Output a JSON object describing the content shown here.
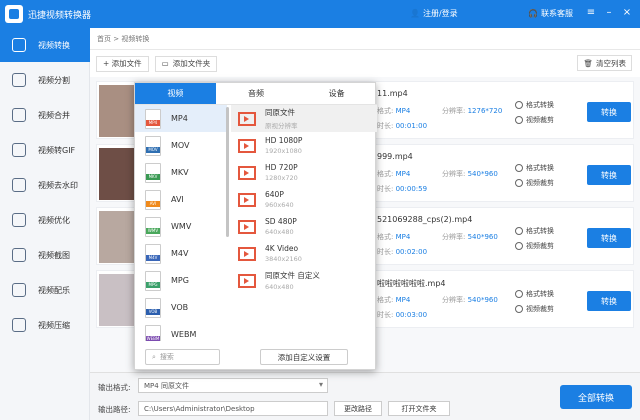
{
  "app": {
    "title": "迅捷视频转换器",
    "login": "注册/登录",
    "support": "联系客服"
  },
  "sidebar": {
    "items": [
      {
        "label": "视频转换"
      },
      {
        "label": "视频分割"
      },
      {
        "label": "视频合并"
      },
      {
        "label": "视频转GIF"
      },
      {
        "label": "视频去水印"
      },
      {
        "label": "视频优化"
      },
      {
        "label": "视频截图"
      },
      {
        "label": "视频配乐"
      },
      {
        "label": "视频压缩"
      }
    ]
  },
  "breadcrumb": "首页 > 视频转换",
  "toolbar": {
    "add_file": "+ 添加文件",
    "add_folder": "添加文件夹",
    "clear": "清空列表"
  },
  "files": [
    {
      "name": "11.mp4",
      "format_label": "格式:",
      "format": "MP4",
      "res_label": "分辨率:",
      "res": "1276*720",
      "dur_label": "时长:",
      "dur": "00:01:00"
    },
    {
      "name": "999.mp4",
      "format_label": "格式:",
      "format": "MP4",
      "res_label": "分辨率:",
      "res": "540*960",
      "dur_label": "时长:",
      "dur": "00:00:59"
    },
    {
      "name": "521069288_cps(2).mp4",
      "format_label": "格式:",
      "format": "MP4",
      "res_label": "分辨率:",
      "res": "540*960",
      "dur_label": "时长:",
      "dur": "00:02:00"
    },
    {
      "name": "啦啦啦啦啦啦.mp4",
      "format_label": "格式:",
      "format": "MP4",
      "res_label": "分辨率:",
      "res": "540*960",
      "dur_label": "时长:",
      "dur": "00:03:00"
    }
  ],
  "card_actions": {
    "format_convert": "格式转换",
    "video_crop": "视频裁剪",
    "convert": "转换"
  },
  "popup": {
    "tabs": [
      "视频",
      "音频",
      "设备"
    ],
    "formats": [
      {
        "name": "MP4",
        "color": "#e4573d"
      },
      {
        "name": "MOV",
        "color": "#2f6fb2"
      },
      {
        "name": "MKV",
        "color": "#3a9a54"
      },
      {
        "name": "AVI",
        "color": "#f08a1c"
      },
      {
        "name": "WMV",
        "color": "#4aa85c"
      },
      {
        "name": "M4V",
        "color": "#3966b8"
      },
      {
        "name": "MPG",
        "color": "#3aa06a"
      },
      {
        "name": "VOB",
        "color": "#2c5fae"
      },
      {
        "name": "WEBM",
        "color": "#7c4bb0"
      }
    ],
    "resolutions": [
      {
        "name": "同原文件",
        "res": "原视分辨率"
      },
      {
        "name": "HD 1080P",
        "res": "1920x1080"
      },
      {
        "name": "HD 720P",
        "res": "1280x720"
      },
      {
        "name": "640P",
        "res": "960x640"
      },
      {
        "name": "SD 480P",
        "res": "640x480"
      },
      {
        "name": "4K Video",
        "res": "3840x2160"
      },
      {
        "name": "同原文件 自定义",
        "res": "640x480"
      }
    ],
    "search_placeholder": "搜索",
    "add_custom": "添加自定义设置"
  },
  "bottom": {
    "output_format_label": "输出格式:",
    "output_format": "MP4   同原文件",
    "output_path_label": "输出路径:",
    "output_path": "C:\\Users\\Administrator\\Desktop",
    "change_path": "更改路径",
    "open_folder": "打开文件夹",
    "convert_all": "全部转换"
  }
}
